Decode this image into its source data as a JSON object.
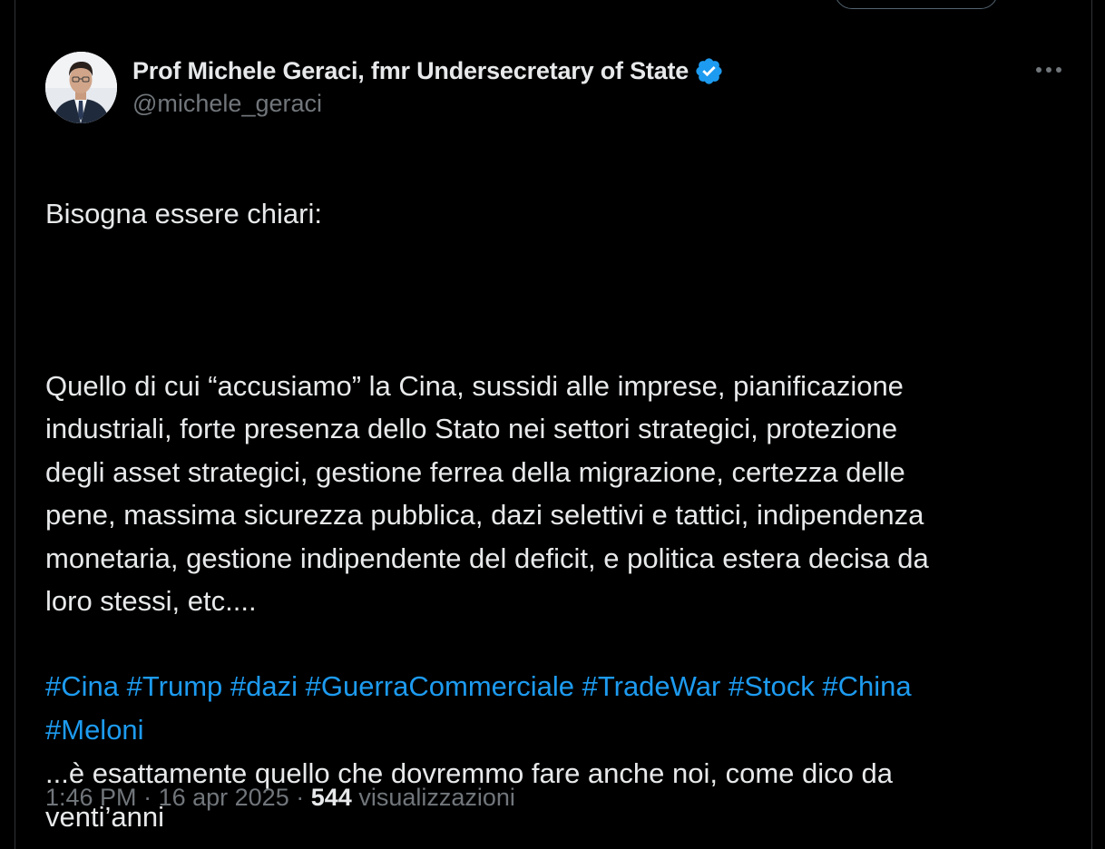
{
  "author": {
    "display_name": "Prof Michele Geraci, fmr Undersecretary of State",
    "handle": "@michele_geraci",
    "verified": true,
    "verified_icon": "verified-badge-icon",
    "avatar_icon": "profile-photo"
  },
  "more_icon": "more-options-icon",
  "tweet": {
    "line_intro": "Bisogna essere chiari:",
    "paragraph_main": "Quello di cui “accusiamo” la Cina, sussidi alle imprese, pianificazione\nindustriali, forte presenza dello Stato nei settori strategici, protezione\ndegli asset strategici, gestione ferrea della migrazione, certezza delle\npene, massima sicurezza pubblica, dazi selettivi e tattici, indipendenza\nmonetaria, gestione indipendente del deficit, e politica estera decisa da\nloro stessi, etc....",
    "paragraph_conclusion": "...è esattamente quello che dovremmo fare anche noi, come dico da\nventi’anni",
    "hashtags": [
      "#Cina",
      "#Trump",
      "#dazi",
      "#GuerraCommerciale",
      "#TradeWar",
      "#Stock",
      "#China",
      "#Meloni"
    ]
  },
  "meta": {
    "time": "1:46 PM",
    "separator": "·",
    "date": "16 apr 2025",
    "views_count": "544",
    "views_label": "visualizzazioni"
  },
  "colors": {
    "background": "#000000",
    "text_primary": "#e7e9ea",
    "text_secondary": "#71767b",
    "accent": "#1d9bf0",
    "border": "#2f3336"
  }
}
